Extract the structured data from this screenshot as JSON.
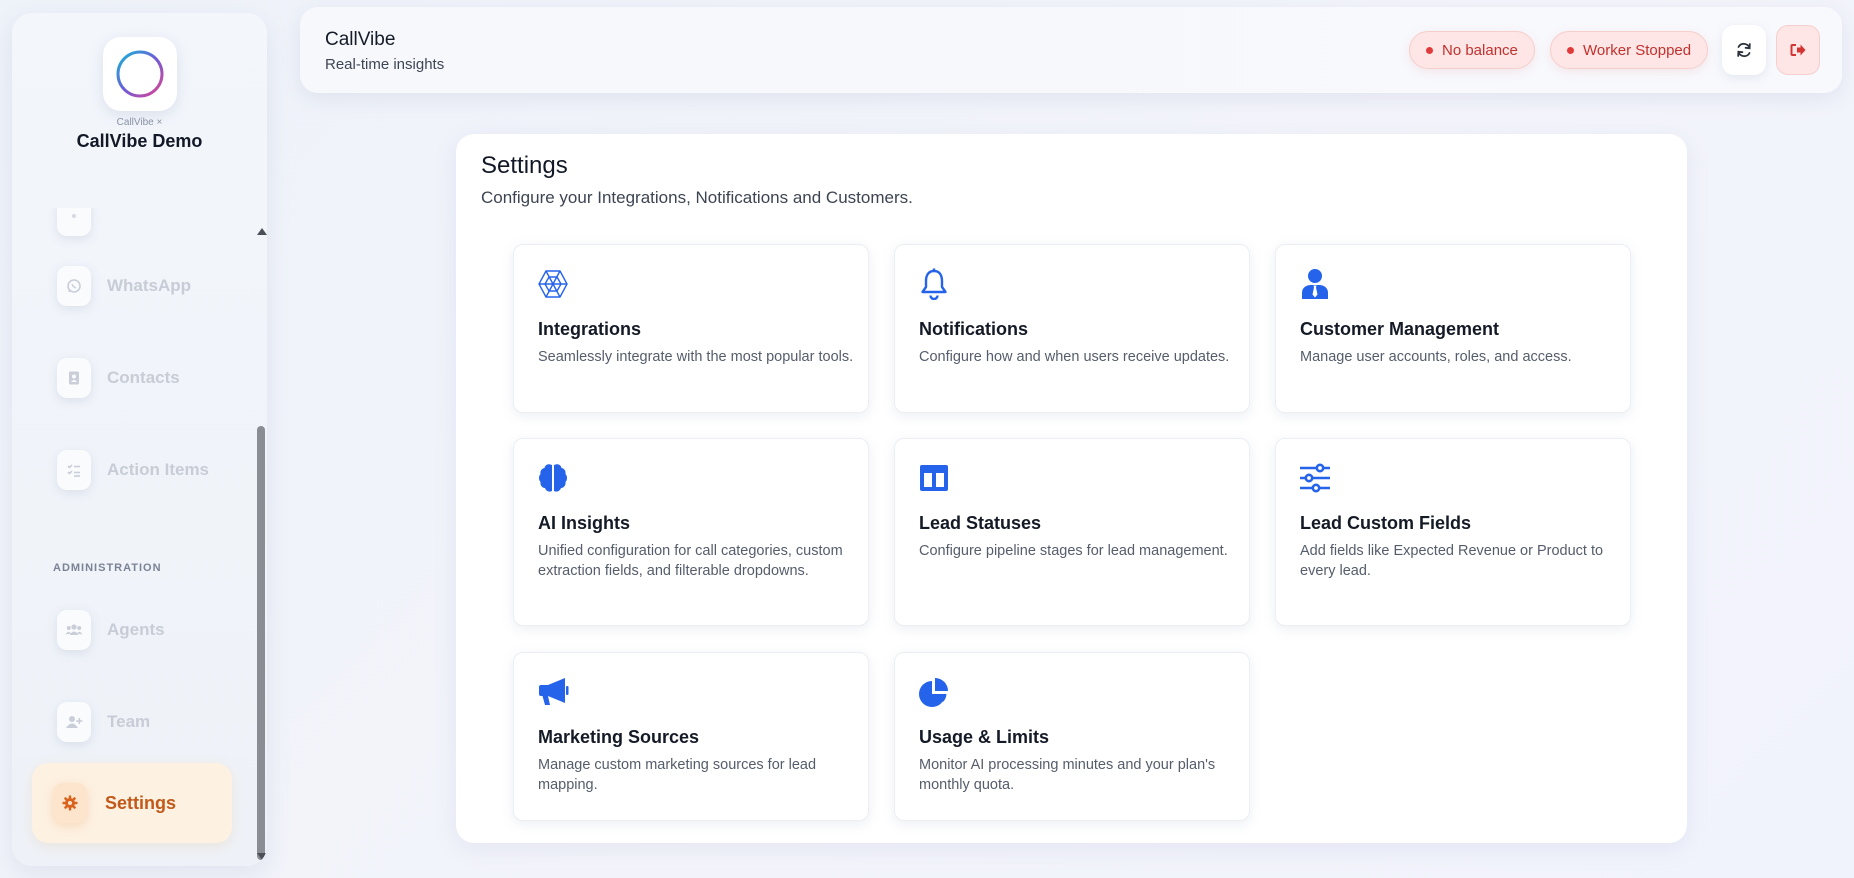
{
  "brand": {
    "sub": "CallVibe ×",
    "name": "CallVibe Demo"
  },
  "sidebar": {
    "items": [
      {
        "label": "WhatsApp",
        "icon": "whatsapp-icon"
      },
      {
        "label": "Contacts",
        "icon": "contacts-icon"
      },
      {
        "label": "Action Items",
        "icon": "checklist-icon"
      },
      {
        "label": "Agents",
        "icon": "users-icon"
      },
      {
        "label": "Team",
        "icon": "user-plus-icon"
      }
    ],
    "section_admin": "ADMINISTRATION",
    "active": {
      "label": "Settings",
      "icon": "gear-icon"
    }
  },
  "header": {
    "title": "CallVibe",
    "subtitle": "Real-time insights",
    "status_balance": "No balance",
    "status_worker": "Worker Stopped"
  },
  "settings": {
    "title": "Settings",
    "subtitle": "Configure your Integrations, Notifications and Customers.",
    "cards": [
      {
        "title": "Integrations",
        "desc": "Seamlessly integrate with the most popular tools.",
        "icon": "integrations-icon"
      },
      {
        "title": "Notifications",
        "desc": "Configure how and when users receive updates.",
        "icon": "bell-icon"
      },
      {
        "title": "Customer Management",
        "desc": "Manage user accounts, roles, and access.",
        "icon": "user-tie-icon"
      },
      {
        "title": "AI Insights",
        "desc": "Unified configuration for call categories, custom extraction fields, and filterable dropdowns.",
        "icon": "brain-icon"
      },
      {
        "title": "Lead Statuses",
        "desc": "Configure pipeline stages for lead management.",
        "icon": "columns-icon"
      },
      {
        "title": "Lead Custom Fields",
        "desc": "Add fields like Expected Revenue or Product to every lead.",
        "icon": "sliders-icon"
      },
      {
        "title": "Marketing Sources",
        "desc": "Manage custom marketing sources for lead mapping.",
        "icon": "megaphone-icon"
      },
      {
        "title": "Usage & Limits",
        "desc": "Monitor AI processing minutes and your plan's monthly quota.",
        "icon": "pie-chart-icon"
      }
    ]
  },
  "colors": {
    "accent": "#2563eb",
    "active_nav": "#c2591a",
    "danger": "#c2312e"
  }
}
